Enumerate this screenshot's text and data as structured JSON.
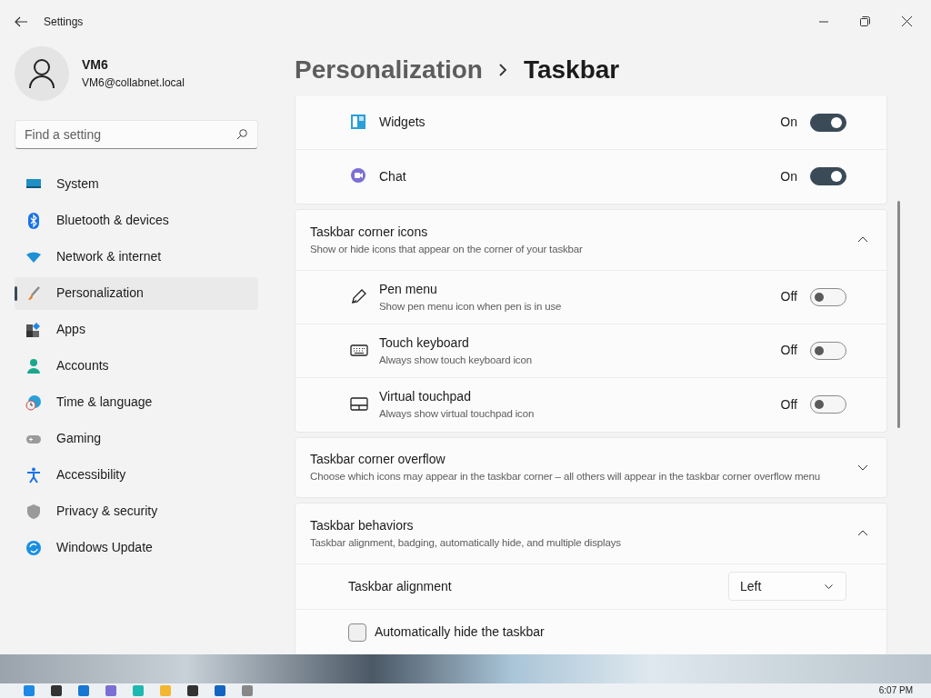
{
  "window": {
    "title": "Settings"
  },
  "user": {
    "name": "VM6",
    "email": "VM6@collabnet.local"
  },
  "search": {
    "placeholder": "Find a setting"
  },
  "nav": [
    {
      "label": "System",
      "kind": "system",
      "selected": false
    },
    {
      "label": "Bluetooth & devices",
      "kind": "bluetooth",
      "selected": false
    },
    {
      "label": "Network & internet",
      "kind": "network",
      "selected": false
    },
    {
      "label": "Personalization",
      "kind": "brush",
      "selected": true
    },
    {
      "label": "Apps",
      "kind": "apps",
      "selected": false
    },
    {
      "label": "Accounts",
      "kind": "accounts",
      "selected": false
    },
    {
      "label": "Time & language",
      "kind": "time",
      "selected": false
    },
    {
      "label": "Gaming",
      "kind": "gaming",
      "selected": false
    },
    {
      "label": "Accessibility",
      "kind": "accessibility",
      "selected": false
    },
    {
      "label": "Privacy & security",
      "kind": "privacy",
      "selected": false
    },
    {
      "label": "Windows Update",
      "kind": "update",
      "selected": false
    }
  ],
  "breadcrumb": [
    "Personalization",
    "Taskbar"
  ],
  "sections": [
    {
      "items": [
        {
          "kind": "toggle",
          "label": "Widgets",
          "state_text": "On",
          "on": true
        },
        {
          "kind": "toggle",
          "label": "Chat",
          "state_text": "On",
          "on": true
        }
      ]
    },
    {
      "title": "Taskbar corner icons",
      "subtitle": "Show or hide icons that appear on the corner of your taskbar",
      "expanded": true,
      "items": [
        {
          "kind": "toggle",
          "label": "Pen menu",
          "sublabel": "Show pen menu icon when pen is in use",
          "state_text": "Off",
          "on": false
        },
        {
          "kind": "toggle",
          "label": "Touch keyboard",
          "sublabel": "Always show touch keyboard icon",
          "state_text": "Off",
          "on": false
        },
        {
          "kind": "toggle",
          "label": "Virtual touchpad",
          "sublabel": "Always show virtual touchpad icon",
          "state_text": "Off",
          "on": false
        }
      ]
    },
    {
      "title": "Taskbar corner overflow",
      "subtitle": "Choose which icons may appear in the taskbar corner – all others will appear in the taskbar corner overflow menu",
      "expanded": false
    },
    {
      "title": "Taskbar behaviors",
      "subtitle": "Taskbar alignment, badging, automatically hide, and multiple displays",
      "expanded": true,
      "items": [
        {
          "kind": "dropdown",
          "label": "Taskbar alignment",
          "value": "Left"
        },
        {
          "kind": "checkbox",
          "label": "Automatically hide the taskbar",
          "checked": false
        }
      ]
    }
  ],
  "taskbar": {
    "clock": "6:07 PM"
  }
}
